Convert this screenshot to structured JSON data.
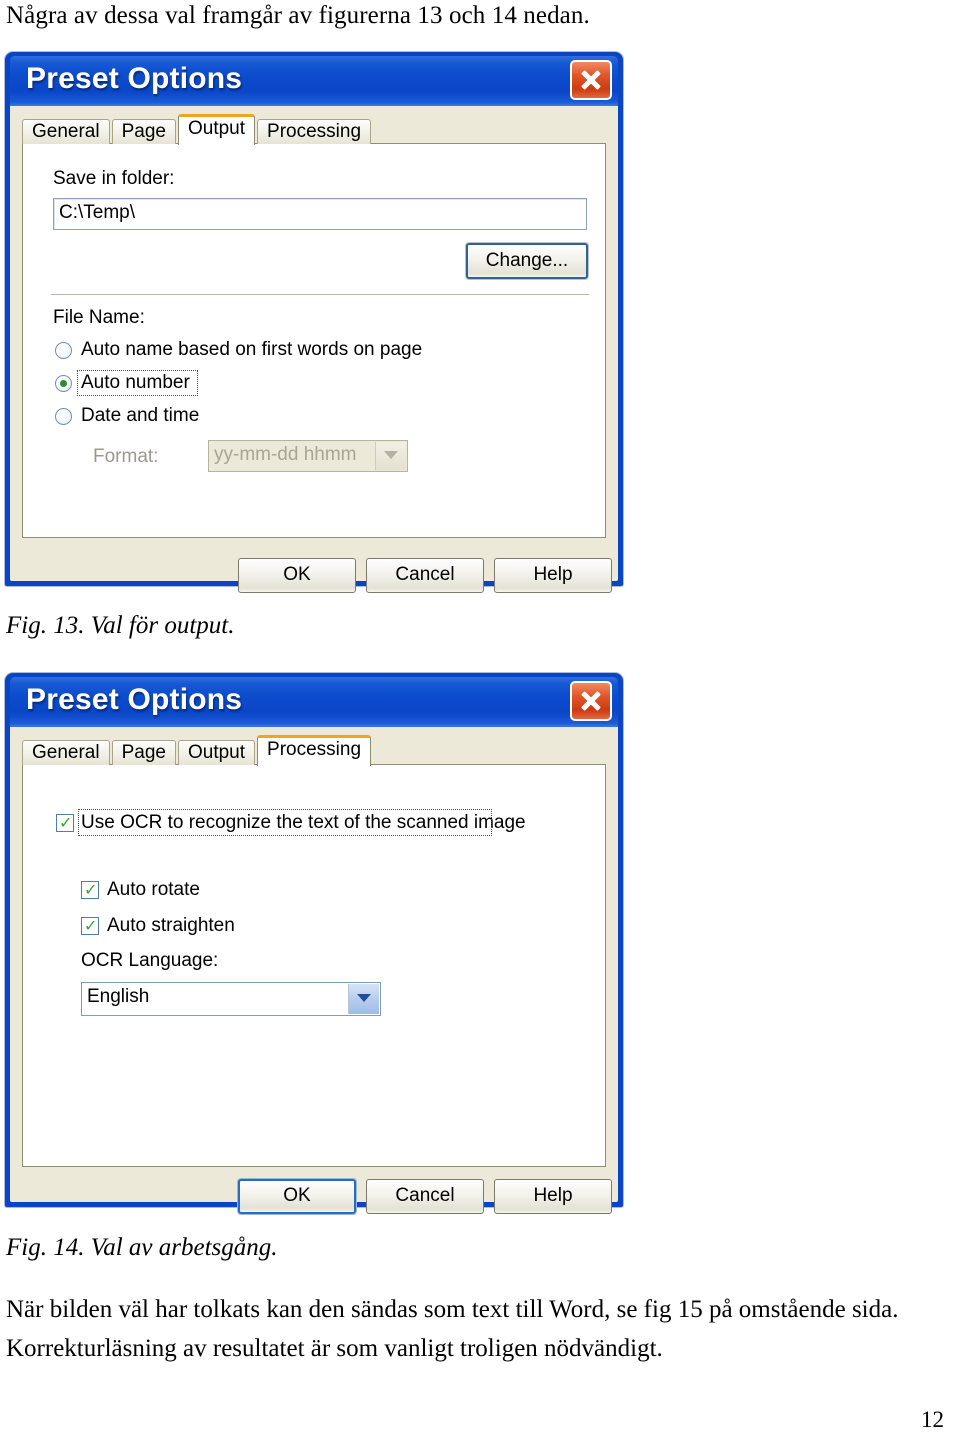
{
  "document": {
    "intro_line": "Några av dessa val framgår av figurerna 13 och 14 nedan.",
    "fig13_caption": "Fig. 13. Val för output.",
    "fig14_caption": "Fig. 14. Val av arbetsgång.",
    "body_line_1": "När bilden väl har tolkats kan den sändas som text till Word, se fig 15 på omstående sida.",
    "body_line_2": "Korrekturläsning av resultatet är som vanligt troligen nödvändigt.",
    "page_number": "12"
  },
  "colors": {
    "titlebar_blue": "#0a46c8",
    "dialog_face": "#ece9d8",
    "close_red": "#cc3b12",
    "active_tab_accent": "#f0a420",
    "radio_dot_green": "#2f8a2f",
    "check_green": "#34a434",
    "combo_arrow_blue": "#1d4f9e"
  },
  "dialog_output": {
    "title": "Preset Options",
    "close_icon": "close-icon",
    "tabs": [
      {
        "label": "General",
        "active": false
      },
      {
        "label": "Page",
        "active": false
      },
      {
        "label": "Output",
        "active": true
      },
      {
        "label": "Processing",
        "active": false
      }
    ],
    "save_in_folder_label": "Save in folder:",
    "folder_path_value": "C:\\Temp\\",
    "folder_path_placeholder": "C:\\Temp\\",
    "change_button": "Change...",
    "file_name_label": "File Name:",
    "radio_options": [
      {
        "label": "Auto name based on first words on page",
        "selected": false,
        "focused": false
      },
      {
        "label": "Auto number",
        "selected": true,
        "focused": true
      },
      {
        "label": "Date and time",
        "selected": false,
        "focused": false
      }
    ],
    "format_label": "Format:",
    "format_value": "yy-mm-dd hhmm",
    "format_enabled": false,
    "buttons": [
      {
        "label": "OK",
        "default": false
      },
      {
        "label": "Cancel",
        "default": false
      },
      {
        "label": "Help",
        "default": false
      }
    ]
  },
  "dialog_processing": {
    "title": "Preset Options",
    "close_icon": "close-icon",
    "tabs": [
      {
        "label": "General",
        "active": false
      },
      {
        "label": "Page",
        "active": false
      },
      {
        "label": "Output",
        "active": false
      },
      {
        "label": "Processing",
        "active": true
      }
    ],
    "use_ocr_checkbox": {
      "label": "Use OCR to recognize the text of the scanned image",
      "checked": true,
      "focused": true
    },
    "auto_rotate_checkbox": {
      "label": "Auto rotate",
      "checked": true
    },
    "auto_straighten_checkbox": {
      "label": "Auto straighten",
      "checked": true
    },
    "ocr_language_label": "OCR Language:",
    "ocr_language_value": "English",
    "buttons": [
      {
        "label": "OK",
        "default": true
      },
      {
        "label": "Cancel",
        "default": false
      },
      {
        "label": "Help",
        "default": false
      }
    ]
  }
}
